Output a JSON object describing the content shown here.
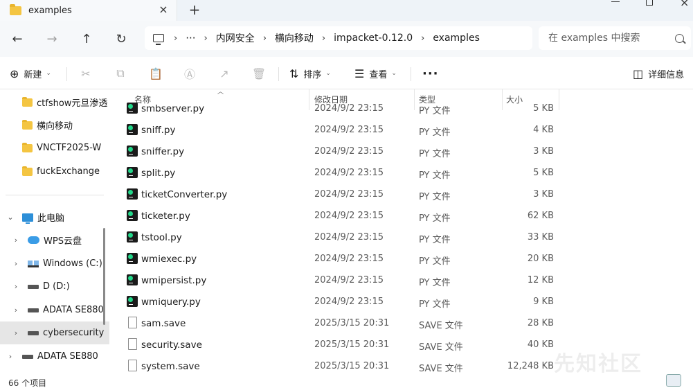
{
  "window": {
    "tab_title": "examples",
    "tab_close": "×",
    "tab_add": "+",
    "close_glyph": "×"
  },
  "nav": {
    "back": "←",
    "forward": "→",
    "up": "↑",
    "refresh": "↻",
    "ellipsis": "···",
    "breadcrumbs": [
      "内网安全",
      "横向移动",
      "impacket-0.12.0",
      "examples"
    ],
    "separator": "›"
  },
  "search": {
    "placeholder": "在 examples 中搜索"
  },
  "commands": {
    "new_label": "新建",
    "sort_label": "排序",
    "view_label": "查看",
    "more": "···",
    "details_label": "详细信息"
  },
  "sidebar": {
    "items": [
      {
        "label": "ctfshow元旦渗透",
        "kind": "folder"
      },
      {
        "label": "横向移动",
        "kind": "folder"
      },
      {
        "label": "VNCTF2025-W",
        "kind": "folder"
      },
      {
        "label": "fuckExchange",
        "kind": "folder"
      },
      {
        "label": "此电脑",
        "kind": "pc",
        "expanded": true
      },
      {
        "label": "WPS云盘",
        "kind": "cloud"
      },
      {
        "label": "Windows (C:)",
        "kind": "windows-drive"
      },
      {
        "label": "D (D:)",
        "kind": "drive"
      },
      {
        "label": "ADATA SE880",
        "kind": "drive"
      },
      {
        "label": "cybersecurity",
        "kind": "drive",
        "selected": true
      },
      {
        "label": "ADATA SE880",
        "kind": "drive"
      }
    ]
  },
  "columns": {
    "name": "名称",
    "date": "修改日期",
    "type": "类型",
    "size": "大小"
  },
  "files": [
    {
      "name": "smbserver.py",
      "date": "2024/9/2 23:15",
      "type": "PY 文件",
      "size": "5 KB",
      "icon": "pycharm-icon"
    },
    {
      "name": "sniff.py",
      "date": "2024/9/2 23:15",
      "type": "PY 文件",
      "size": "4 KB",
      "icon": "pycharm-icon"
    },
    {
      "name": "sniffer.py",
      "date": "2024/9/2 23:15",
      "type": "PY 文件",
      "size": "3 KB",
      "icon": "pycharm-icon"
    },
    {
      "name": "split.py",
      "date": "2024/9/2 23:15",
      "type": "PY 文件",
      "size": "5 KB",
      "icon": "pycharm-icon"
    },
    {
      "name": "ticketConverter.py",
      "date": "2024/9/2 23:15",
      "type": "PY 文件",
      "size": "3 KB",
      "icon": "pycharm-icon"
    },
    {
      "name": "ticketer.py",
      "date": "2024/9/2 23:15",
      "type": "PY 文件",
      "size": "62 KB",
      "icon": "pycharm-icon"
    },
    {
      "name": "tstool.py",
      "date": "2024/9/2 23:15",
      "type": "PY 文件",
      "size": "33 KB",
      "icon": "pycharm-icon"
    },
    {
      "name": "wmiexec.py",
      "date": "2024/9/2 23:15",
      "type": "PY 文件",
      "size": "20 KB",
      "icon": "pycharm-icon"
    },
    {
      "name": "wmipersist.py",
      "date": "2024/9/2 23:15",
      "type": "PY 文件",
      "size": "12 KB",
      "icon": "pycharm-icon"
    },
    {
      "name": "wmiquery.py",
      "date": "2024/9/2 23:15",
      "type": "PY 文件",
      "size": "9 KB",
      "icon": "pycharm-icon"
    },
    {
      "name": "sam.save",
      "date": "2025/3/15 20:31",
      "type": "SAVE 文件",
      "size": "28 KB",
      "icon": "document-icon"
    },
    {
      "name": "security.save",
      "date": "2025/3/15 20:31",
      "type": "SAVE 文件",
      "size": "40 KB",
      "icon": "document-icon"
    },
    {
      "name": "system.save",
      "date": "2025/3/15 20:31",
      "type": "SAVE 文件",
      "size": "12,248 KB",
      "icon": "document-icon"
    }
  ],
  "status": {
    "item_count": "66 个项目"
  },
  "watermark": "先知社区"
}
